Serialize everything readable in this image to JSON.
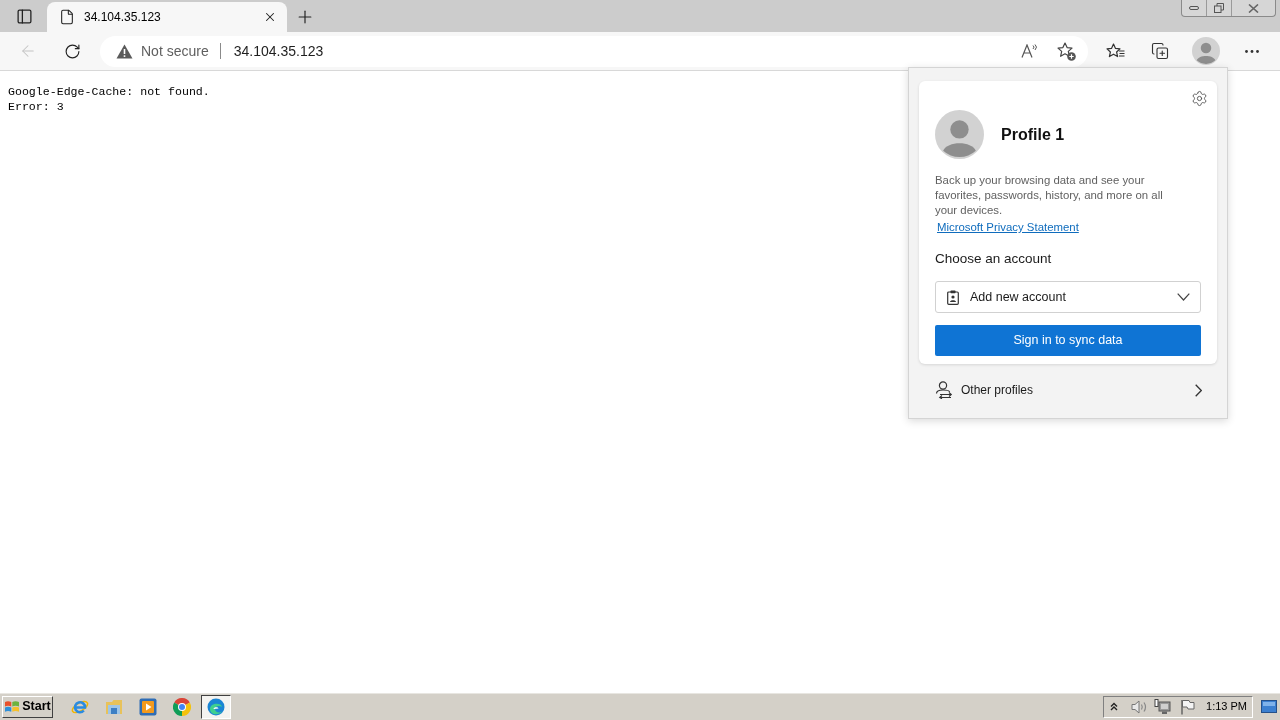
{
  "tabs": [
    {
      "title": "34.104.35.123",
      "selected": true
    }
  ],
  "navigation": {
    "back": {
      "disabled": true
    }
  },
  "address_bar": {
    "security_label": "Not secure",
    "url": "34.104.35.123"
  },
  "page": {
    "lines": [
      "Google-Edge-Cache: not found.",
      "Error: 3"
    ]
  },
  "profile_flyout": {
    "profile_name": "Profile 1",
    "description": "Back up your browsing data and see your favorites, passwords, history, and more on all your devices.",
    "privacy_link": "Microsoft Privacy Statement",
    "choose_label": "Choose an account",
    "account_select": {
      "value": "Add new account"
    },
    "sign_in_button": "Sign in to sync data",
    "other_profiles": "Other profiles"
  },
  "taskbar": {
    "start": "Start",
    "apps": [
      {
        "kind": "browser",
        "selected": false
      },
      {
        "kind": "folder",
        "selected": false
      },
      {
        "kind": "player",
        "selected": false
      },
      {
        "kind": "ring",
        "selected": false
      },
      {
        "kind": "wave",
        "selected": true
      }
    ],
    "clock": "1:13 PM"
  }
}
